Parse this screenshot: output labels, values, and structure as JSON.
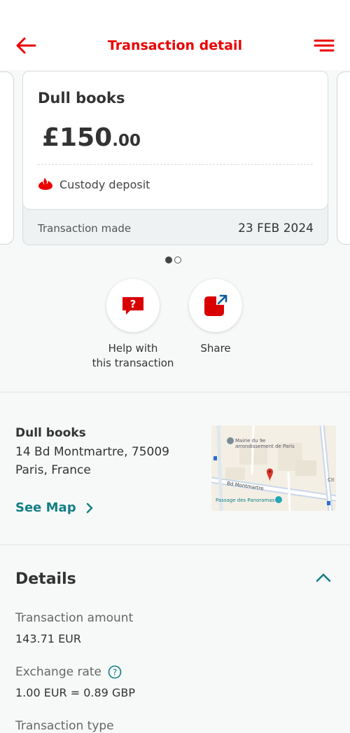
{
  "header": {
    "title": "Transaction detail",
    "back_icon": "arrow-left-icon",
    "menu_icon": "hamburger-menu-icon"
  },
  "card": {
    "merchant": "Dull books",
    "amount_main": "£150",
    "amount_decimals": ".00",
    "category": "Custody deposit",
    "footer_label": "Transaction made",
    "footer_date": "23 FEB 2024"
  },
  "carousel": {
    "total": 2,
    "active": 1
  },
  "actions": {
    "help_label": "Help with\nthis transaction",
    "share_label": "Share"
  },
  "address": {
    "name": "Dull books",
    "line1": "14 Bd Montmartre, 75009",
    "line2": "Paris, France",
    "see_map": "See Map"
  },
  "map": {
    "label_mairie": "Mairie du 9e",
    "label_arr": "arrondissement de Paris",
    "label_street": "Bd Montmartre",
    "label_passage": "Passage des Panoramas",
    "label_cit": "Cit"
  },
  "details": {
    "title": "Details",
    "amount_label": "Transaction amount",
    "amount_value": "143.71 EUR",
    "rate_label": "Exchange rate",
    "rate_value": "1.00 EUR = 0.89 GBP",
    "type_label": "Transaction type"
  },
  "colors": {
    "brand_red": "#ec0000",
    "teal": "#137e84",
    "background": "#f7f9f9"
  }
}
